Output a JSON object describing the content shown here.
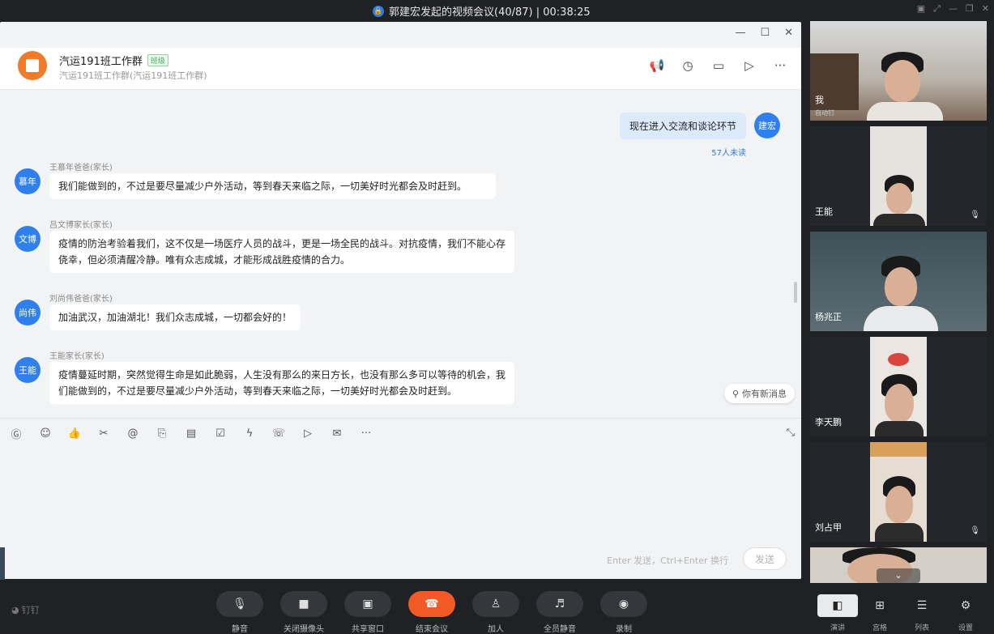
{
  "meeting": {
    "title": "郭建宏发起的视频会议(40/87) | 00:38:25"
  },
  "group": {
    "name": "汽运191班工作群",
    "badge": "班级",
    "subtitle": "汽运191班工作群(汽运191班工作群)"
  },
  "self_message": {
    "text": "现在进入交流和谈论环节",
    "unread": "57人未读",
    "avatar": "建宏"
  },
  "messages": [
    {
      "avatar": "慕年",
      "sender": "王慕年爸爸(家长)",
      "text": "我们能做到的，不过是要尽量减少户外活动，等到春天来临之际，一切美好时光都会及时赶到。"
    },
    {
      "avatar": "文博",
      "sender": "吕文博家长(家长)",
      "text": "疫情的防治考验着我们，这不仅是一场医疗人员的战斗，更是一场全民的战斗。对抗疫情，我们不能心存侥幸，但必须清醒冷静。唯有众志成城，才能形成战胜疫情的合力。"
    },
    {
      "avatar": "尚伟",
      "sender": "刘尚伟爸爸(家长)",
      "text": "加油武汉，加油湖北！我们众志成城，一切都会好的！"
    },
    {
      "avatar": "王能",
      "sender": "王能家长(家长)",
      "text": "疫情蔓延时期，突然觉得生命是如此脆弱，人生没有那么的来日方长，也没有那么多可以等待的机会，我们能做到的，不过是要尽量减少户外活动，等到春天来临之际，一切美好时光都会及时赶到。"
    }
  ],
  "new_message_tip": "你有新消息",
  "composer": {
    "hint": "Enter 发送，Ctrl+Enter 换行",
    "send": "发送"
  },
  "participants": [
    {
      "name": "我",
      "tag": "自动钉"
    },
    {
      "name": "王能"
    },
    {
      "name": "杨兆正"
    },
    {
      "name": "李天鹏"
    },
    {
      "name": "刘占甲"
    }
  ],
  "controls": {
    "mute": "静音",
    "camera": "关闭摄像头",
    "share": "共享窗口",
    "end": "结束会议",
    "add": "加人",
    "mute_all": "全员静音",
    "record": "录制"
  },
  "views": {
    "speaker": "演讲",
    "grid": "宫格",
    "list": "列表",
    "settings": "设置"
  },
  "brand": "钉钉"
}
